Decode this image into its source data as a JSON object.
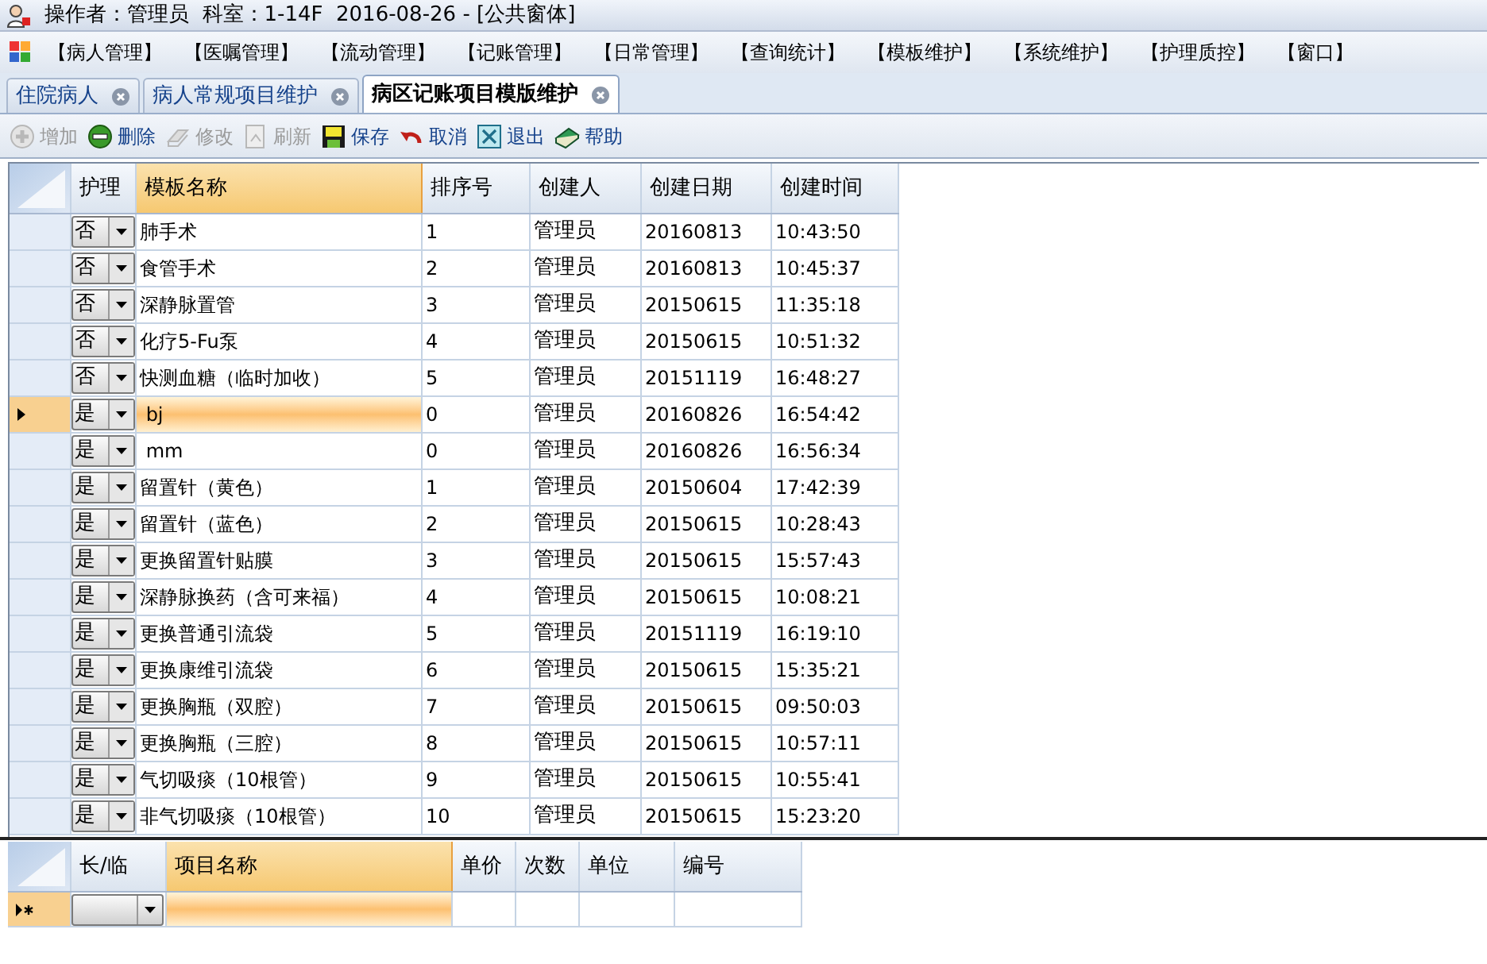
{
  "window": {
    "title": "操作者：管理员  科室：1-14F  2016-08-26 - [公共窗体]"
  },
  "menu": [
    "【病人管理】",
    "【医嘱管理】",
    "【流动管理】",
    "【记账管理】",
    "【日常管理】",
    "【查询统计】",
    "【模板维护】",
    "【系统维护】",
    "【护理质控】",
    "【窗口】"
  ],
  "tabs": [
    {
      "label": "住院病人",
      "selected": false
    },
    {
      "label": "病人常规项目维护",
      "selected": false
    },
    {
      "label": "病区记账项目模版维护",
      "selected": true
    }
  ],
  "toolbar": [
    {
      "label": "增加",
      "kind": "add",
      "disabled": true
    },
    {
      "label": "删除",
      "kind": "delete",
      "disabled": false
    },
    {
      "label": "修改",
      "kind": "edit",
      "disabled": true
    },
    {
      "label": "刷新",
      "kind": "refresh",
      "disabled": true
    },
    {
      "label": "保存",
      "kind": "save",
      "disabled": false
    },
    {
      "label": "取消",
      "kind": "undo",
      "disabled": false
    },
    {
      "label": "退出",
      "kind": "exit",
      "disabled": false
    },
    {
      "label": "帮助",
      "kind": "help",
      "disabled": false
    }
  ],
  "template_table": {
    "columns": [
      "护理",
      "模板名称",
      "排序号",
      "创建人",
      "创建日期",
      "创建时间"
    ],
    "rows": [
      {
        "nursing": "否",
        "name": "肺手术",
        "order": "1",
        "creator": "管理员",
        "date": "20160813",
        "time": "10:43:50",
        "selected": false
      },
      {
        "nursing": "否",
        "name": "食管手术",
        "order": "2",
        "creator": "管理员",
        "date": "20160813",
        "time": "10:45:37",
        "selected": false
      },
      {
        "nursing": "否",
        "name": "深静脉置管",
        "order": "3",
        "creator": "管理员",
        "date": "20150615",
        "time": "11:35:18",
        "selected": false
      },
      {
        "nursing": "否",
        "name": "化疗5-Fu泵",
        "order": "4",
        "creator": "管理员",
        "date": "20150615",
        "time": "10:51:32",
        "selected": false
      },
      {
        "nursing": "否",
        "name": "快测血糖（临时加收）",
        "order": "5",
        "creator": "管理员",
        "date": "20151119",
        "time": "16:48:27",
        "selected": false
      },
      {
        "nursing": "是",
        "name": " bj",
        "order": "0",
        "creator": "管理员",
        "date": "20160826",
        "time": "16:54:42",
        "selected": true
      },
      {
        "nursing": "是",
        "name": " mm",
        "order": "0",
        "creator": "管理员",
        "date": "20160826",
        "time": "16:56:34",
        "selected": false
      },
      {
        "nursing": "是",
        "name": "留置针（黄色）",
        "order": "1",
        "creator": "管理员",
        "date": "20150604",
        "time": "17:42:39",
        "selected": false
      },
      {
        "nursing": "是",
        "name": "留置针（蓝色）",
        "order": "2",
        "creator": "管理员",
        "date": "20150615",
        "time": "10:28:43",
        "selected": false
      },
      {
        "nursing": "是",
        "name": "更换留置针贴膜",
        "order": "3",
        "creator": "管理员",
        "date": "20150615",
        "time": "15:57:43",
        "selected": false
      },
      {
        "nursing": "是",
        "name": "深静脉换药（含可来福）",
        "order": "4",
        "creator": "管理员",
        "date": "20150615",
        "time": "10:08:21",
        "selected": false
      },
      {
        "nursing": "是",
        "name": "更换普通引流袋",
        "order": "5",
        "creator": "管理员",
        "date": "20151119",
        "time": "16:19:10",
        "selected": false
      },
      {
        "nursing": "是",
        "name": "更换康维引流袋",
        "order": "6",
        "creator": "管理员",
        "date": "20150615",
        "time": "15:35:21",
        "selected": false
      },
      {
        "nursing": "是",
        "name": "更换胸瓶（双腔）",
        "order": "7",
        "creator": "管理员",
        "date": "20150615",
        "time": "09:50:03",
        "selected": false
      },
      {
        "nursing": "是",
        "name": "更换胸瓶（三腔）",
        "order": "8",
        "creator": "管理员",
        "date": "20150615",
        "time": "10:57:11",
        "selected": false
      },
      {
        "nursing": "是",
        "name": "气切吸痰（10根管）",
        "order": "9",
        "creator": "管理员",
        "date": "20150615",
        "time": "10:55:41",
        "selected": false
      },
      {
        "nursing": "是",
        "name": "非气切吸痰（10根管）",
        "order": "10",
        "creator": "管理员",
        "date": "20150615",
        "time": "15:23:20",
        "selected": false
      }
    ]
  },
  "item_table": {
    "columns": [
      "长/临",
      "项目名称",
      "单价",
      "次数",
      "单位",
      "编号"
    ]
  }
}
